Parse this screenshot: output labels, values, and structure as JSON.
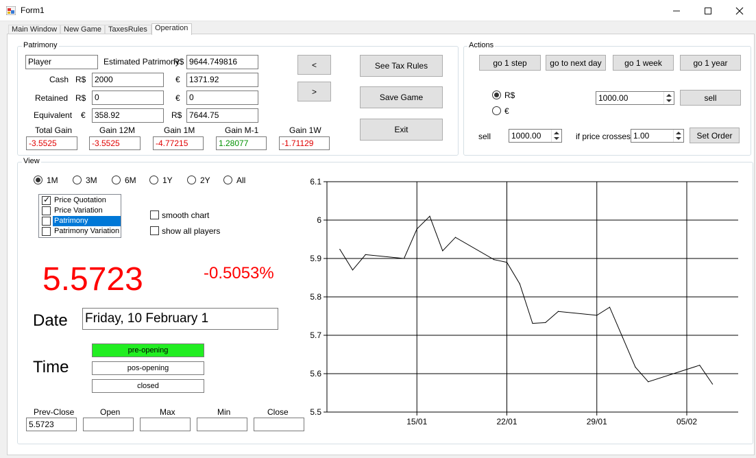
{
  "window": {
    "title": "Form1",
    "minimize_icon": "minimize-icon",
    "maximize_icon": "maximize-icon",
    "close_icon": "close-icon"
  },
  "tabs": [
    {
      "label": "Main Window"
    },
    {
      "label": "New Game"
    },
    {
      "label": "TaxesRules"
    },
    {
      "label": "Operation",
      "active": true
    }
  ],
  "patrimony": {
    "legend": "Patrimony",
    "player_name": "Player",
    "estimated_label": "Estimated Patrimony",
    "estimated_currency": "R$",
    "estimated_value": "9644.749816",
    "cash_label": "Cash",
    "cash_brl_currency": "R$",
    "cash_brl": "2000",
    "cash_eur_currency": "€",
    "cash_eur": "1371.92",
    "retained_label": "Retained",
    "retained_brl_currency": "R$",
    "retained_brl": "0",
    "retained_eur_currency": "€",
    "retained_eur": "0",
    "equivalent_label": "Equivalent",
    "equivalent_eur_currency": "€",
    "equivalent_eur": "358.92",
    "equivalent_brl_currency": "R$",
    "equivalent_brl": "7644.75",
    "gains": [
      {
        "label": "Total Gain",
        "value": "-3.5525",
        "color": "#e00000"
      },
      {
        "label": "Gain 12M",
        "value": "-3.5525",
        "color": "#e00000"
      },
      {
        "label": "Gain 1M",
        "value": "-4.77215",
        "color": "#e00000"
      },
      {
        "label": "Gain M-1",
        "value": "1.28077",
        "color": "#009000"
      },
      {
        "label": "Gain 1W",
        "value": "-1.71129",
        "color": "#e00000"
      }
    ],
    "prev_button": "<",
    "next_button": ">",
    "see_tax_rules": "See Tax Rules",
    "save_game": "Save Game",
    "exit": "Exit"
  },
  "actions": {
    "legend": "Actions",
    "go_1_step": "go 1 step",
    "go_next_day": "go to next day",
    "go_1_week": "go 1 week",
    "go_1_year": "go 1 year",
    "currency_brl": "R$",
    "currency_eur": "€",
    "selected_currency": "R$",
    "sell_amount": "1000.00",
    "sell_button": "sell",
    "sell_label": "sell",
    "order_amount": "1000.00",
    "if_price_crosses_label": "if price crosses",
    "price_threshold": "1.00",
    "set_order": "Set Order"
  },
  "view": {
    "legend": "View",
    "periods": [
      "1M",
      "3M",
      "6M",
      "1Y",
      "2Y",
      "All"
    ],
    "selected_period": "1M",
    "series_options": [
      {
        "label": "Price Quotation",
        "checked": true,
        "selected": false
      },
      {
        "label": "Price Variation",
        "checked": false,
        "selected": false
      },
      {
        "label": "Patrimony",
        "checked": false,
        "selected": true
      },
      {
        "label": "Patrimony Variation",
        "checked": false,
        "selected": false
      }
    ],
    "smooth_chart": "smooth chart",
    "show_all_players": "show all players",
    "current_price": "5.5723",
    "variation": "-0.5053%",
    "date_label": "Date",
    "date_value": "Friday, 10 February 1",
    "time_label": "Time",
    "time_states": [
      {
        "label": "pre-opening",
        "active": true
      },
      {
        "label": "pos-opening",
        "active": false
      },
      {
        "label": "closed",
        "active": false
      }
    ],
    "ohlc": [
      {
        "label": "Prev-Close",
        "value": "5.5723"
      },
      {
        "label": "Open",
        "value": ""
      },
      {
        "label": "Max",
        "value": ""
      },
      {
        "label": "Min",
        "value": ""
      },
      {
        "label": "Close",
        "value": ""
      }
    ],
    "accent_red": "#ff0000"
  },
  "chart_data": {
    "type": "line",
    "title": "",
    "xlabel": "",
    "ylabel": "",
    "ylim": [
      5.5,
      6.1
    ],
    "yticks": [
      6.1,
      6.0,
      5.9,
      5.8,
      5.7,
      5.6,
      5.5
    ],
    "ytick_labels": [
      "6.1",
      "6",
      "5.9",
      "5.8",
      "5.7",
      "5.6",
      "5.5"
    ],
    "xticks": [
      {
        "label": "15/01",
        "x": 8
      },
      {
        "label": "22/01",
        "x": 15
      },
      {
        "label": "29/01",
        "x": 22
      },
      {
        "label": "05/02",
        "x": 29
      }
    ],
    "xlim": [
      1,
      33
    ],
    "grid": true,
    "series": [
      {
        "x": [
          2,
          3,
          4,
          7,
          8,
          9,
          10,
          11,
          14,
          15,
          16,
          17,
          18,
          19,
          22,
          23,
          24,
          25,
          26,
          30,
          31
        ],
        "values": [
          5.924,
          5.87,
          5.91,
          5.9,
          5.977,
          6.01,
          5.92,
          5.955,
          5.897,
          5.89,
          5.834,
          5.731,
          5.733,
          5.762,
          5.752,
          5.773,
          5.695,
          5.617,
          5.579,
          5.622,
          5.573
        ],
        "color": "#000000"
      }
    ]
  }
}
